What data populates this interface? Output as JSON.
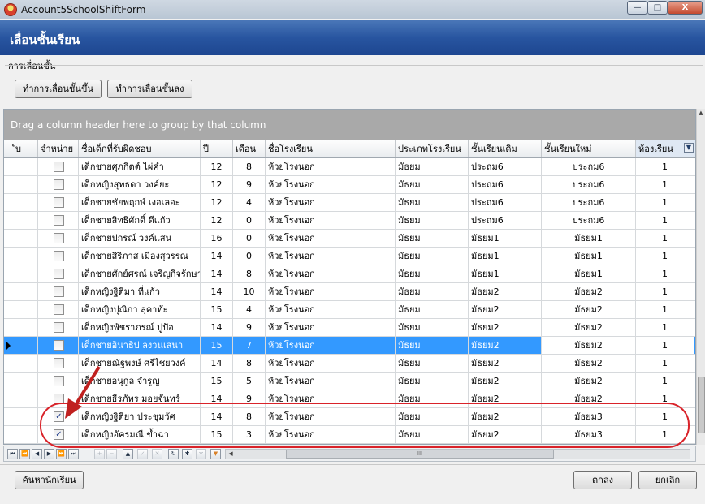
{
  "window": {
    "title": "Account5SchoolShiftForm",
    "min_glyph": "—",
    "max_glyph": "□",
    "close_glyph": "X"
  },
  "form": {
    "title": "เลื่อนชั้นเรียน",
    "group_caption": "การเลื่อนชั้น"
  },
  "actions": {
    "promote": "ทำการเลื่อนชั้นขึ้น",
    "demote": "ทำการเลื่อนชั้นลง"
  },
  "grid": {
    "group_panel_text": "Drag a column header here to group by that column",
    "columns": [
      "ับ",
      "จำหน่าย",
      "ชื่อเด็กที่รับผิดชอบ",
      "ปี",
      "เดือน",
      "ชื่อโรงเรียน",
      "ประเภทโรงเรียน",
      "ชั้นเรียนเดิม",
      "ชั้นเรียนใหม่",
      "ห้องเรียน"
    ],
    "filter_icon": "filter-dropdown-icon",
    "rows": [
      {
        "checked": false,
        "name": "เด็กชายศุภกิตต์ ไผ่คำ",
        "age": "12",
        "month": "8",
        "school": "ห้วยโรงนอก",
        "type": "มัธยม",
        "old": "ประถม6",
        "new": "ประถม6",
        "room": "1",
        "selected": false
      },
      {
        "checked": false,
        "name": "เด็กหญิงสุทธดา วงค์ยะ",
        "age": "12",
        "month": "9",
        "school": "ห้วยโรงนอก",
        "type": "มัธยม",
        "old": "ประถม6",
        "new": "ประถม6",
        "room": "1",
        "selected": false
      },
      {
        "checked": false,
        "name": "เด็กชายชัยพฤกษ์ เงอเลอะ",
        "age": "12",
        "month": "4",
        "school": "ห้วยโรงนอก",
        "type": "มัธยม",
        "old": "ประถม6",
        "new": "ประถม6",
        "room": "1",
        "selected": false
      },
      {
        "checked": false,
        "name": "เด็กชายสิทธิศักดิ์ ดีแก้ว",
        "age": "12",
        "month": "0",
        "school": "ห้วยโรงนอก",
        "type": "มัธยม",
        "old": "ประถม6",
        "new": "ประถม6",
        "room": "1",
        "selected": false
      },
      {
        "checked": false,
        "name": "เด็กชายปกรณ์ วงค์แสน",
        "age": "16",
        "month": "0",
        "school": "ห้วยโรงนอก",
        "type": "มัธยม",
        "old": "มัธยม1",
        "new": "มัธยม1",
        "room": "1",
        "selected": false
      },
      {
        "checked": false,
        "name": "เด็กชายสิริภาส เมืองสุวรรณ",
        "age": "14",
        "month": "0",
        "school": "ห้วยโรงนอก",
        "type": "มัธยม",
        "old": "มัธยม1",
        "new": "มัธยม1",
        "room": "1",
        "selected": false
      },
      {
        "checked": false,
        "name": "เด็กชายศักย์ศรณ์ เจริญกิจรักษา",
        "age": "14",
        "month": "8",
        "school": "ห้วยโรงนอก",
        "type": "มัธยม",
        "old": "มัธยม1",
        "new": "มัธยม1",
        "room": "1",
        "selected": false
      },
      {
        "checked": false,
        "name": "เด็กหญิงฐิติมา ที่แก้ว",
        "age": "14",
        "month": "10",
        "school": "ห้วยโรงนอก",
        "type": "มัธยม",
        "old": "มัธยม2",
        "new": "มัธยม2",
        "room": "1",
        "selected": false
      },
      {
        "checked": false,
        "name": "เด็กหญิงปุณิกา ลุคาทัะ",
        "age": "15",
        "month": "4",
        "school": "ห้วยโรงนอก",
        "type": "มัธยม",
        "old": "มัธยม2",
        "new": "มัธยม2",
        "room": "1",
        "selected": false
      },
      {
        "checked": false,
        "name": "เด็กหญิงพัชราภรณ์ ปูป้อ",
        "age": "14",
        "month": "9",
        "school": "ห้วยโรงนอก",
        "type": "มัธยม",
        "old": "มัธยม2",
        "new": "มัธยม2",
        "room": "1",
        "selected": false
      },
      {
        "checked": false,
        "name": "เด็กชายอินาธิป ลงวนเสนา",
        "age": "15",
        "month": "7",
        "school": "ห้วยโรงนอก",
        "type": "มัธยม",
        "old": "มัธยม2",
        "new": "มัธยม2",
        "room": "1",
        "selected": true
      },
      {
        "checked": false,
        "name": "เด็กชายณัฐพงษ์ ศรีไชยวงค์",
        "age": "14",
        "month": "8",
        "school": "ห้วยโรงนอก",
        "type": "มัธยม",
        "old": "มัธยม2",
        "new": "มัธยม2",
        "room": "1",
        "selected": false
      },
      {
        "checked": false,
        "name": "เด็กชายอนุกูล จำรูญ",
        "age": "15",
        "month": "5",
        "school": "ห้วยโรงนอก",
        "type": "มัธยม",
        "old": "มัธยม2",
        "new": "มัธยม2",
        "room": "1",
        "selected": false
      },
      {
        "checked": false,
        "name": "เด็กชายธีรภัทร มอยจันทร์",
        "age": "14",
        "month": "9",
        "school": "ห้วยโรงนอก",
        "type": "มัธยม",
        "old": "มัธยม2",
        "new": "มัธยม2",
        "room": "1",
        "selected": false
      },
      {
        "checked": true,
        "name": "เด็กหญิงฐิติยา ประชุมวัศ",
        "age": "14",
        "month": "8",
        "school": "ห้วยโรงนอก",
        "type": "มัธยม",
        "old": "มัธยม2",
        "new": "มัธยม3",
        "room": "1",
        "selected": false
      },
      {
        "checked": true,
        "name": "เด็กหญิงอัครมณี ข้ำฉา",
        "age": "15",
        "month": "3",
        "school": "ห้วยโรงนอก",
        "type": "มัธยม",
        "old": "มัธยม2",
        "new": "มัธยม3",
        "room": "1",
        "selected": false
      }
    ]
  },
  "navigator": {
    "buttons": [
      {
        "icon": "first-record-icon",
        "glyph": "⏮",
        "enabled": true
      },
      {
        "icon": "prev-page-icon",
        "glyph": "⏪",
        "enabled": true
      },
      {
        "icon": "prev-record-icon",
        "glyph": "◀",
        "enabled": true
      },
      {
        "icon": "next-record-icon",
        "glyph": "▶",
        "enabled": true
      },
      {
        "icon": "next-page-icon",
        "glyph": "⏩",
        "enabled": true
      },
      {
        "icon": "last-record-icon",
        "glyph": "⏭",
        "enabled": true
      },
      {
        "icon": "append-icon",
        "glyph": "+",
        "enabled": false
      },
      {
        "icon": "delete-icon",
        "glyph": "−",
        "enabled": false
      },
      {
        "icon": "edit-icon",
        "glyph": "▲",
        "enabled": true
      },
      {
        "icon": "post-icon",
        "glyph": "✓",
        "enabled": false
      },
      {
        "icon": "cancel-edit-icon",
        "glyph": "✕",
        "enabled": false
      },
      {
        "icon": "refresh-icon",
        "glyph": "↻",
        "enabled": true
      },
      {
        "icon": "bookmark-icon",
        "glyph": "✱",
        "enabled": true
      },
      {
        "icon": "goto-bookmark-icon",
        "glyph": "✲",
        "enabled": false
      },
      {
        "icon": "filter-icon",
        "glyph": "▼",
        "enabled": true
      }
    ],
    "scroll_grip": "III"
  },
  "footer": {
    "search": "ค้นหานักเรียน",
    "ok": "ตกลง",
    "cancel": "ยกเลิก"
  },
  "colors": {
    "selection": "#3399ff",
    "annotation": "#d9232a",
    "header_band": "#2855a0"
  }
}
